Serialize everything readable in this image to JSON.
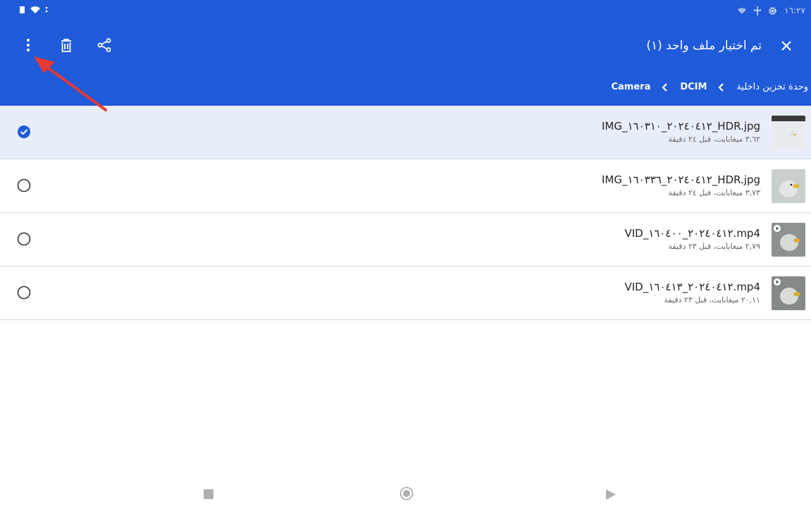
{
  "status_bar": {
    "time": "١٦:٢٧"
  },
  "app_bar": {
    "title": "تم اختيار ملف واحد (١)"
  },
  "breadcrumb": [
    {
      "label": "وحدة تخزين داخلية"
    },
    {
      "label": "DCIM"
    },
    {
      "label": "Camera"
    }
  ],
  "files": [
    {
      "name": "IMG_٢٠٢٤٠٤١٢_١٦٠٣١٠_HDR.jpg",
      "meta": "٣,٦٢ ميغابايت، قبل ٢٤ دقيقة",
      "selected": true,
      "type": "image"
    },
    {
      "name": "IMG_٢٠٢٤٠٤١٢_١٦٠٣٣٦_HDR.jpg",
      "meta": "٣,٧٣ ميغابايت، قبل ٢٤ دقيقة",
      "selected": false,
      "type": "image"
    },
    {
      "name": "VID_٢٠٢٤٠٤١٢_١٦٠٤٠٠.mp4",
      "meta": "٢,٧٩ ميغابايت، قبل ٢٣ دقيقة",
      "selected": false,
      "type": "video"
    },
    {
      "name": "VID_٢٠٢٤٠٤١٢_١٦٠٤١٣.mp4",
      "meta": "٢٠,١١ ميغابايت، قبل ٢٣ دقيقة",
      "selected": false,
      "type": "video"
    }
  ],
  "colors": {
    "accent": "#1f5ad9",
    "selected_row": "#e8eef9",
    "annotation": "#e53935"
  }
}
